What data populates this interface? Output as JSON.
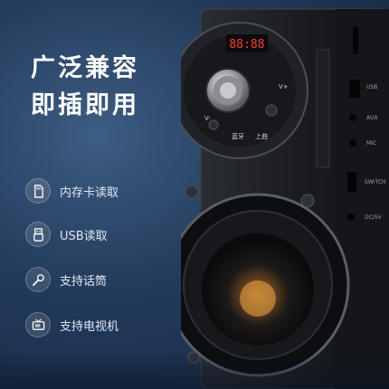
{
  "headline": {
    "line1": "广泛兼容",
    "line2": "即插即用"
  },
  "features": [
    {
      "icon": "memory-card-icon",
      "label": "内存卡读取"
    },
    {
      "icon": "usb-icon",
      "label": "USB读取"
    },
    {
      "icon": "microphone-icon",
      "label": "支持话筒"
    },
    {
      "icon": "tv-icon",
      "label": "支持电视机"
    }
  ],
  "speaker": {
    "display": "88:88",
    "knob_labels": {
      "left": "V-",
      "right": "V+",
      "bottom_left": "上曲",
      "bottom_right": "下曲",
      "power": "蓝牙",
      "mode": "上曲"
    },
    "side_labels": {
      "usb": "USB",
      "aux": "AUX",
      "mic": "MIC",
      "switch": "SWITCH",
      "dc": "DC/5V"
    }
  },
  "colors": {
    "background": "#223a5a",
    "speaker_body": "#1c1e22",
    "display_red": "#ff3b30",
    "headline": "#ffffff"
  }
}
